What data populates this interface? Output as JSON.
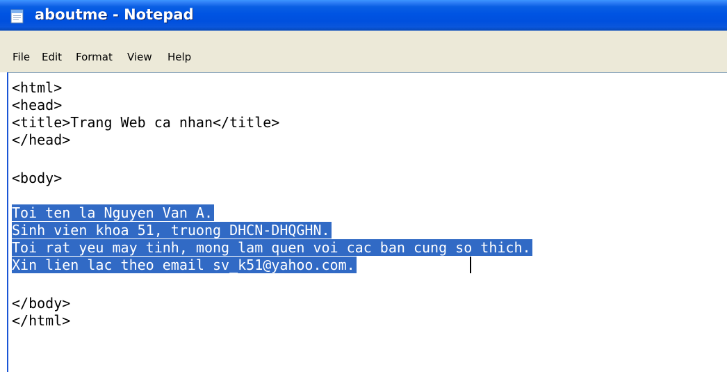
{
  "window": {
    "title": "aboutme - Notepad",
    "app_icon": "notepad-icon",
    "colors": {
      "titlebar": "#0054e3",
      "selection": "#316ac5",
      "menubar": "#ece9d8"
    }
  },
  "menu": {
    "items": [
      "File",
      "Edit",
      "Format",
      "View",
      "Help"
    ]
  },
  "editor": {
    "lines": [
      "<html>",
      "<head>",
      "<title>Trang Web ca nhan</title>",
      "</head>",
      "",
      "<body>",
      "",
      "Toi ten la Nguyen Van A.",
      "Sinh vien khoa 51, truong DHCN-DHQGHN.",
      "Toi rat yeu may tinh, mong lam quen voi cac ban cung so thich.",
      "Xin lien lac theo email sv_k51@yahoo.com.",
      "",
      "</body>",
      "</html>"
    ],
    "selected_lines": [
      7,
      8,
      9,
      10
    ]
  }
}
